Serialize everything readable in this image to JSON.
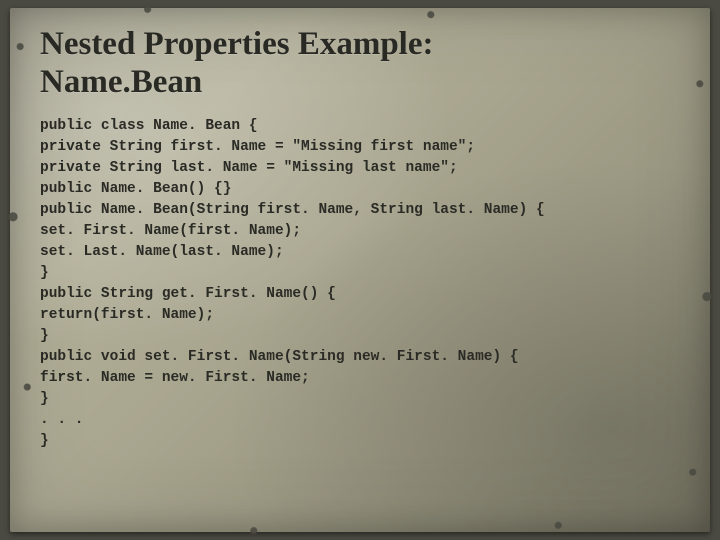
{
  "title": "Nested Properties Example:\nName.Bean",
  "code_lines": [
    "public class Name. Bean {",
    "private String first. Name = \"Missing first name\";",
    "private String last. Name = \"Missing last name\";",
    "public Name. Bean() {}",
    "public Name. Bean(String first. Name, String last. Name) {",
    "set. First. Name(first. Name);",
    "set. Last. Name(last. Name);",
    "}",
    "public String get. First. Name() {",
    "return(first. Name);",
    "}",
    "public void set. First. Name(String new. First. Name) {",
    "first. Name = new. First. Name;",
    "}",
    ". . .",
    "}"
  ]
}
